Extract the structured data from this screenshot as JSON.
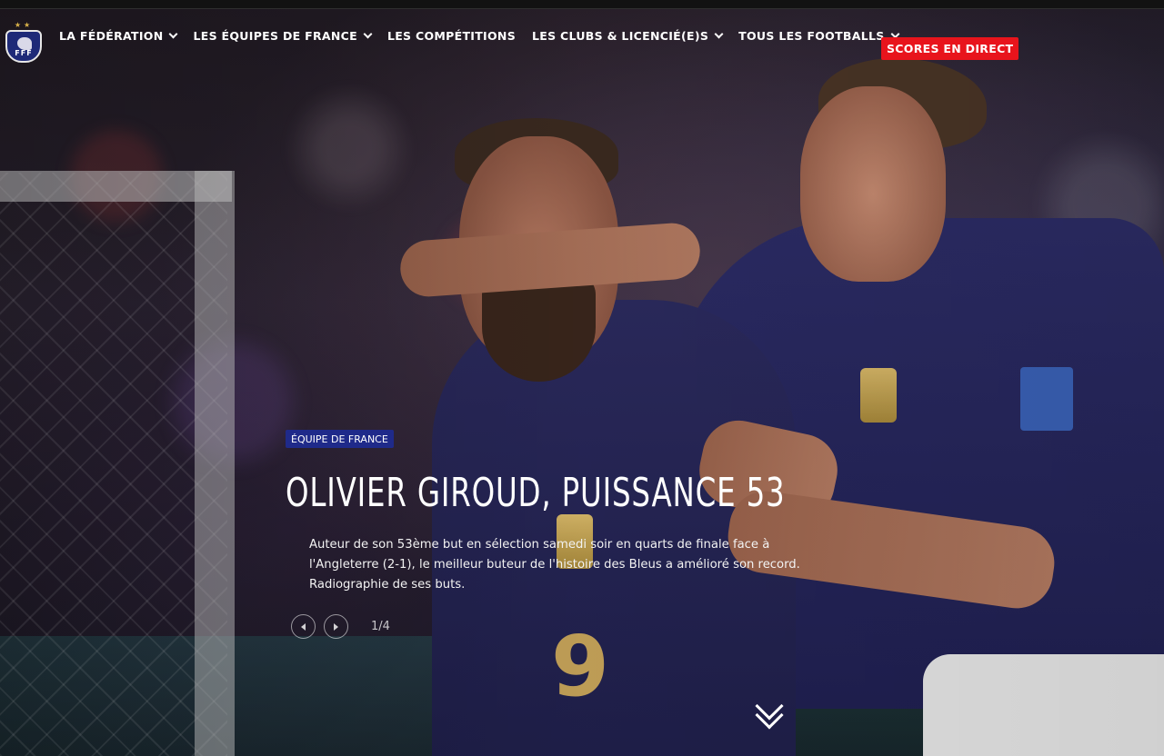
{
  "brand": {
    "logo_text": "FFF",
    "logo_stars": "★★"
  },
  "nav": {
    "items": [
      {
        "label": "LA FÉDÉRATION",
        "has_dropdown": true
      },
      {
        "label": "LES ÉQUIPES DE FRANCE",
        "has_dropdown": true
      },
      {
        "label": "LES COMPÉTITIONS",
        "has_dropdown": false
      },
      {
        "label": "LES CLUBS & LICENCIÉ(E)S",
        "has_dropdown": true
      },
      {
        "label": "TOUS LES FOOTBALLS",
        "has_dropdown": true
      }
    ],
    "live_button": "SCORES EN DIRECT"
  },
  "hero": {
    "category": "ÉQUIPE DE FRANCE",
    "title": "OLIVIER GIROUD, PUISSANCE 53",
    "summary": "Auteur de son 53ème but en sélection samedi soir en quarts de finale face à l'Angleterre (2-1), le meilleur buteur de l'histoire des Bleus a amélioré son record. Radiographie de ses buts.",
    "pager": "1/4",
    "jersey_number": "9"
  },
  "colors": {
    "live_red": "#e8141c",
    "tag_blue": "#1f2a8a",
    "jersey_navy": "#2b2a5e",
    "gold": "#c7a45a"
  },
  "icons": {
    "prev": "chevron-left-icon",
    "next": "chevron-right-icon",
    "scroll": "double-chevron-down-icon",
    "dropdown": "chevron-down-icon"
  }
}
